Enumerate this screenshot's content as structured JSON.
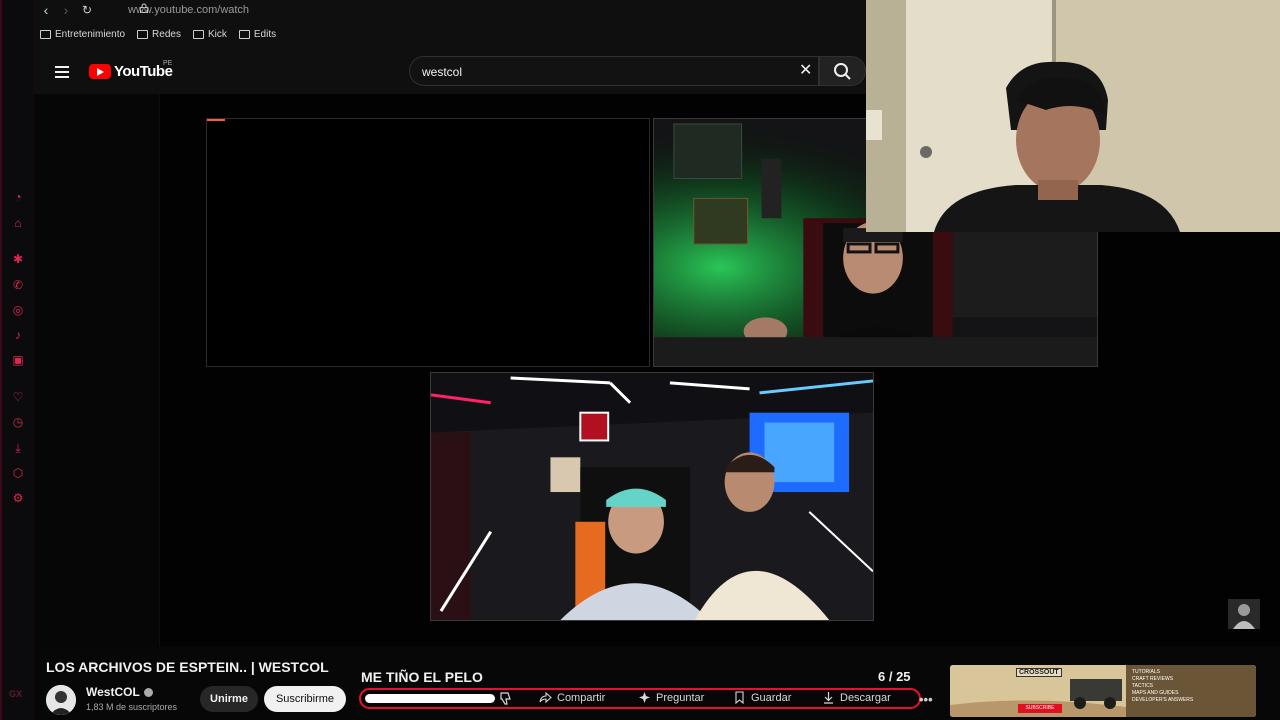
{
  "browser": {
    "url": "www.youtube.com/watch",
    "bookmarks": [
      "Entretenimiento",
      "Redes",
      "Kick",
      "Edits"
    ],
    "sidebar_label": "GX"
  },
  "youtube": {
    "logo_text": "YouTube",
    "region": "PE",
    "search_value": "westcol"
  },
  "video": {
    "title": "LOS ARCHIVOS DE ESPTEIN.. | WESTCOL",
    "channel": {
      "name": "WestCOL",
      "subscribers": "1,83 M de suscriptores"
    },
    "join_label": "Unirme",
    "subscribe_label": "Suscribirme"
  },
  "short": {
    "title": "ME TIÑO EL PELO",
    "counter": "6  / 25",
    "actions": {
      "share": "Compartir",
      "ask": "Preguntar",
      "save": "Guardar",
      "download": "Descargar"
    }
  },
  "ad": {
    "brand": "CROSSOUT",
    "lines": [
      "TUTORIALS",
      "CRAFT REVIEWS",
      "TACTICS",
      "MAPS AND GUIDES",
      "DEVELOPER'S ANSWERS"
    ],
    "subscribe": "SUBSCRIBE"
  },
  "colors": {
    "accent": "#e0284f",
    "youtube_red": "#ff0000",
    "highlight_border": "#e8102c"
  }
}
